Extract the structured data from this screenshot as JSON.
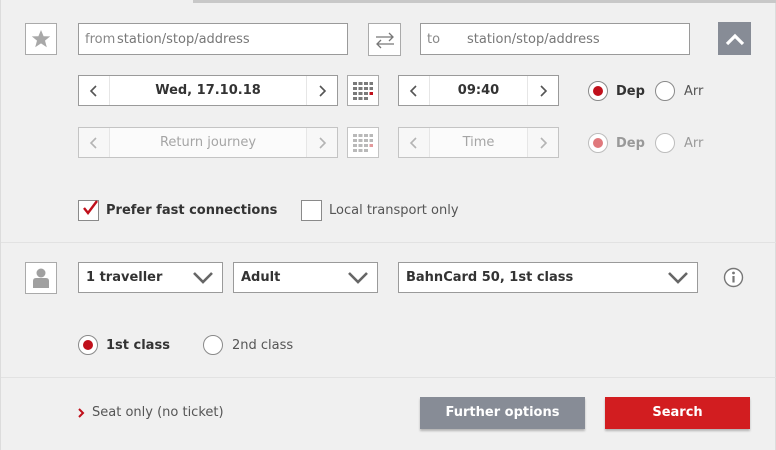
{
  "route": {
    "from_prefix": "from",
    "from_placeholder": "station/stop/address",
    "to_prefix": "to",
    "to_placeholder": "station/stop/address"
  },
  "outbound": {
    "date": "Wed, 17.10.18",
    "time": "09:40",
    "dep_label": "Dep",
    "arr_label": "Arr",
    "dep_selected": true
  },
  "return": {
    "date_placeholder": "Return journey",
    "time_placeholder": "Time",
    "dep_label": "Dep",
    "arr_label": "Arr",
    "dep_selected": true
  },
  "options": {
    "prefer_fast_label": "Prefer fast connections",
    "prefer_fast_checked": true,
    "local_only_label": "Local transport only",
    "local_only_checked": false
  },
  "travellers": {
    "count": "1 traveller",
    "type": "Adult",
    "bahncard": "BahnCard 50, 1st class"
  },
  "travel_class": {
    "first_label": "1st class",
    "second_label": "2nd class",
    "selected": "1st class"
  },
  "footer": {
    "seat_only_label": "Seat only (no ticket)",
    "further_options_label": "Further options",
    "search_label": "Search"
  },
  "colors": {
    "accent_red": "#d21d20",
    "secondary_gray": "#878c96",
    "panel_bg": "#f0f0f0"
  },
  "icons": [
    "star-icon",
    "swap-icon",
    "collapse-chevron-up-icon",
    "calendar-icon",
    "info-icon",
    "person-icon",
    "chevron-right-icon"
  ]
}
